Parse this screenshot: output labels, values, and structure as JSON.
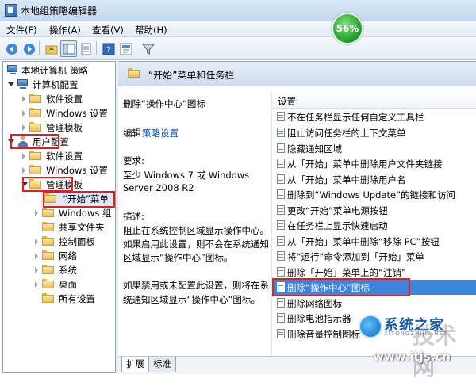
{
  "window": {
    "title": "本地组策略编辑器"
  },
  "menu": [
    {
      "label": "文件(F)"
    },
    {
      "label": "操作(A)"
    },
    {
      "label": "查看(V)"
    },
    {
      "label": "帮助(H)"
    }
  ],
  "toolbar": {
    "icons": [
      "back-arrow-icon",
      "forward-arrow-icon",
      "up-folder-icon",
      "show-tree-icon",
      "export-list-icon",
      "help-icon",
      "properties-icon",
      "filter-icon"
    ]
  },
  "tree": [
    {
      "label": "本地计算机 策略"
    },
    {
      "label": "计算机配置"
    },
    {
      "label": "软件设置"
    },
    {
      "label": "Windows 设置"
    },
    {
      "label": "管理模板"
    },
    {
      "label": "用户配置"
    },
    {
      "label": "软件设置"
    },
    {
      "label": "Windows 设置"
    },
    {
      "label": "管理模板"
    },
    {
      "label": "“开始”菜单"
    },
    {
      "label": "Windows 组"
    },
    {
      "label": "共享文件夹"
    },
    {
      "label": "控制面板"
    },
    {
      "label": "网络"
    },
    {
      "label": "系统"
    },
    {
      "label": "桌面"
    },
    {
      "label": "所有设置"
    }
  ],
  "header": {
    "title": "“开始”菜单和任务栏",
    "badge": "56%"
  },
  "description": {
    "setting_title": "删除“操作中心”图标",
    "edit_prefix": "编辑",
    "edit_link": "策略设置",
    "requirements_label": "要求:",
    "requirements_lines": [
      "至少 Windows 7 或 Windows",
      "Server 2008 R2"
    ],
    "desc_label": "描述:",
    "desc_lines": [
      "阻止在系统控制区域显示操作中心。",
      "如果启用此设置，则不会在系统通知",
      "区域显示“操作中心”图标。"
    ],
    "desc_lines2": [
      "如果禁用或未配置此设置，则将在系",
      "统通知区域显示“操作中心”图标。"
    ]
  },
  "settings": {
    "column_header": "设置",
    "items": [
      {
        "label": "不在任务栏显示任何自定义工具栏"
      },
      {
        "label": "阻止访问任务栏的上下文菜单"
      },
      {
        "label": "隐藏通知区域"
      },
      {
        "label": "从「开始」菜单中删除用户文件夹链接"
      },
      {
        "label": "从「开始」菜单中删除用户名"
      },
      {
        "label": "删除到“Windows Update”的链接和访问"
      },
      {
        "label": "更改“开始”菜单电源按钮"
      },
      {
        "label": "在任务栏上显示快速启动"
      },
      {
        "label": "从「开始」菜单中删除“移除 PC”按钮"
      },
      {
        "label": "将“运行”命令添加到「开始」菜单"
      },
      {
        "label": "删除「开始」菜单上的“注销”"
      },
      {
        "label": "删除“操作中心”图标"
      },
      {
        "label": "删除网络图标"
      },
      {
        "label": "删除电池指示器"
      },
      {
        "label": "删除音量控制图标"
      }
    ]
  },
  "tabs": [
    {
      "label": "扩展"
    },
    {
      "label": "标准"
    }
  ],
  "watermark": {
    "brand": "系统之家",
    "site_small": "XITONGZHIJIA.NET",
    "big": "技术网",
    "url": "www.itjs.cn"
  },
  "colors": {
    "highlight_border": "#e21c22",
    "selection": "#3b85db",
    "badge": "#1f9a2a"
  }
}
